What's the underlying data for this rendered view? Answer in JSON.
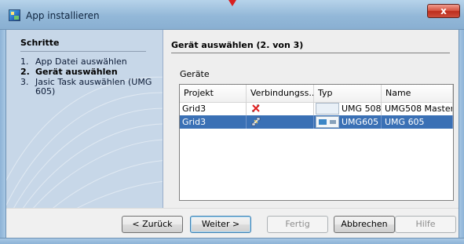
{
  "window": {
    "title": "App installieren",
    "close_glyph": "x"
  },
  "steps": {
    "heading": "Schritte",
    "items": [
      {
        "number": "1.",
        "label": "App Datei auswählen",
        "active": false
      },
      {
        "number": "2.",
        "label": "Gerät auswählen",
        "active": true
      },
      {
        "number": "3.",
        "label": "Jasic Task auswählen (UMG 605)",
        "active": false
      }
    ]
  },
  "main": {
    "title": "Gerät auswählen (2. von 3)",
    "group_label": "Geräte",
    "table": {
      "columns": [
        "Projekt",
        "Verbindungss...",
        "Typ",
        "Name"
      ],
      "rows": [
        {
          "projekt": "Grid3",
          "connection_icon": "disconnected-plug-icon",
          "typ": "UMG 508",
          "name": "UMG508 Master",
          "selected": false
        },
        {
          "projekt": "Grid3",
          "connection_icon": "connected-plug-icon",
          "typ": "UMG605",
          "name": "UMG 605",
          "selected": true
        }
      ]
    }
  },
  "buttons": {
    "back": "< Zurück",
    "next": "Weiter >",
    "finish": "Fertig",
    "cancel": "Abbrechen",
    "help": "Hilfe"
  },
  "colors": {
    "selection": "#3a70b5",
    "titlebar": "#93b8d8",
    "steps_panel": "#c7d7e8",
    "close_button": "#cc4d3b"
  }
}
